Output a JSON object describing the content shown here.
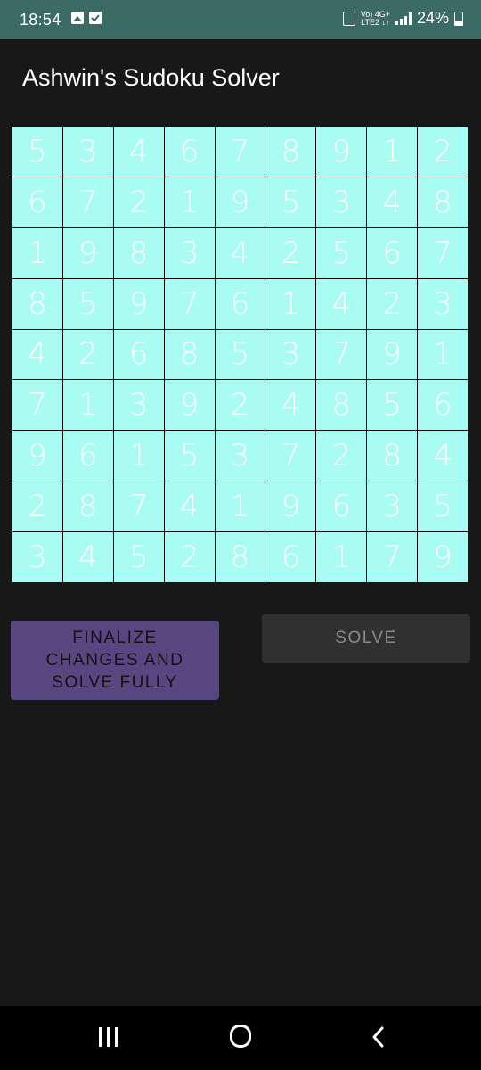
{
  "status_bar": {
    "time": "18:54",
    "network_top": "Vo) 4G+",
    "network_bottom": "LTE2 ↓↑",
    "battery": "24%",
    "icons": [
      "gallery-icon",
      "check-icon",
      "lock-icon",
      "signal-icon",
      "battery-icon"
    ]
  },
  "app": {
    "title": "Ashwin's Sudoku Solver"
  },
  "board": {
    "rows": [
      [
        "5",
        "3",
        "4",
        "6",
        "7",
        "8",
        "9",
        "1",
        "2"
      ],
      [
        "6",
        "7",
        "2",
        "1",
        "9",
        "5",
        "3",
        "4",
        "8"
      ],
      [
        "1",
        "9",
        "8",
        "3",
        "4",
        "2",
        "5",
        "6",
        "7"
      ],
      [
        "8",
        "5",
        "9",
        "7",
        "6",
        "1",
        "4",
        "2",
        "3"
      ],
      [
        "4",
        "2",
        "6",
        "8",
        "5",
        "3",
        "7",
        "9",
        "1"
      ],
      [
        "7",
        "1",
        "3",
        "9",
        "2",
        "4",
        "8",
        "5",
        "6"
      ],
      [
        "9",
        "6",
        "1",
        "5",
        "3",
        "7",
        "2",
        "8",
        "4"
      ],
      [
        "2",
        "8",
        "7",
        "4",
        "1",
        "9",
        "6",
        "3",
        "5"
      ],
      [
        "3",
        "4",
        "5",
        "2",
        "8",
        "6",
        "1",
        "7",
        "9"
      ]
    ],
    "cell_color": "#a9fcf1",
    "digit_color": "#ffffff"
  },
  "buttons": {
    "finalize_label": "FINALIZE CHANGES AND SOLVE FULLY",
    "solve_label": "SOLVE",
    "finalize_color": "#574680",
    "solve_state": "disabled"
  },
  "nav": {
    "icons": [
      "recents-icon",
      "home-icon",
      "back-icon"
    ]
  }
}
